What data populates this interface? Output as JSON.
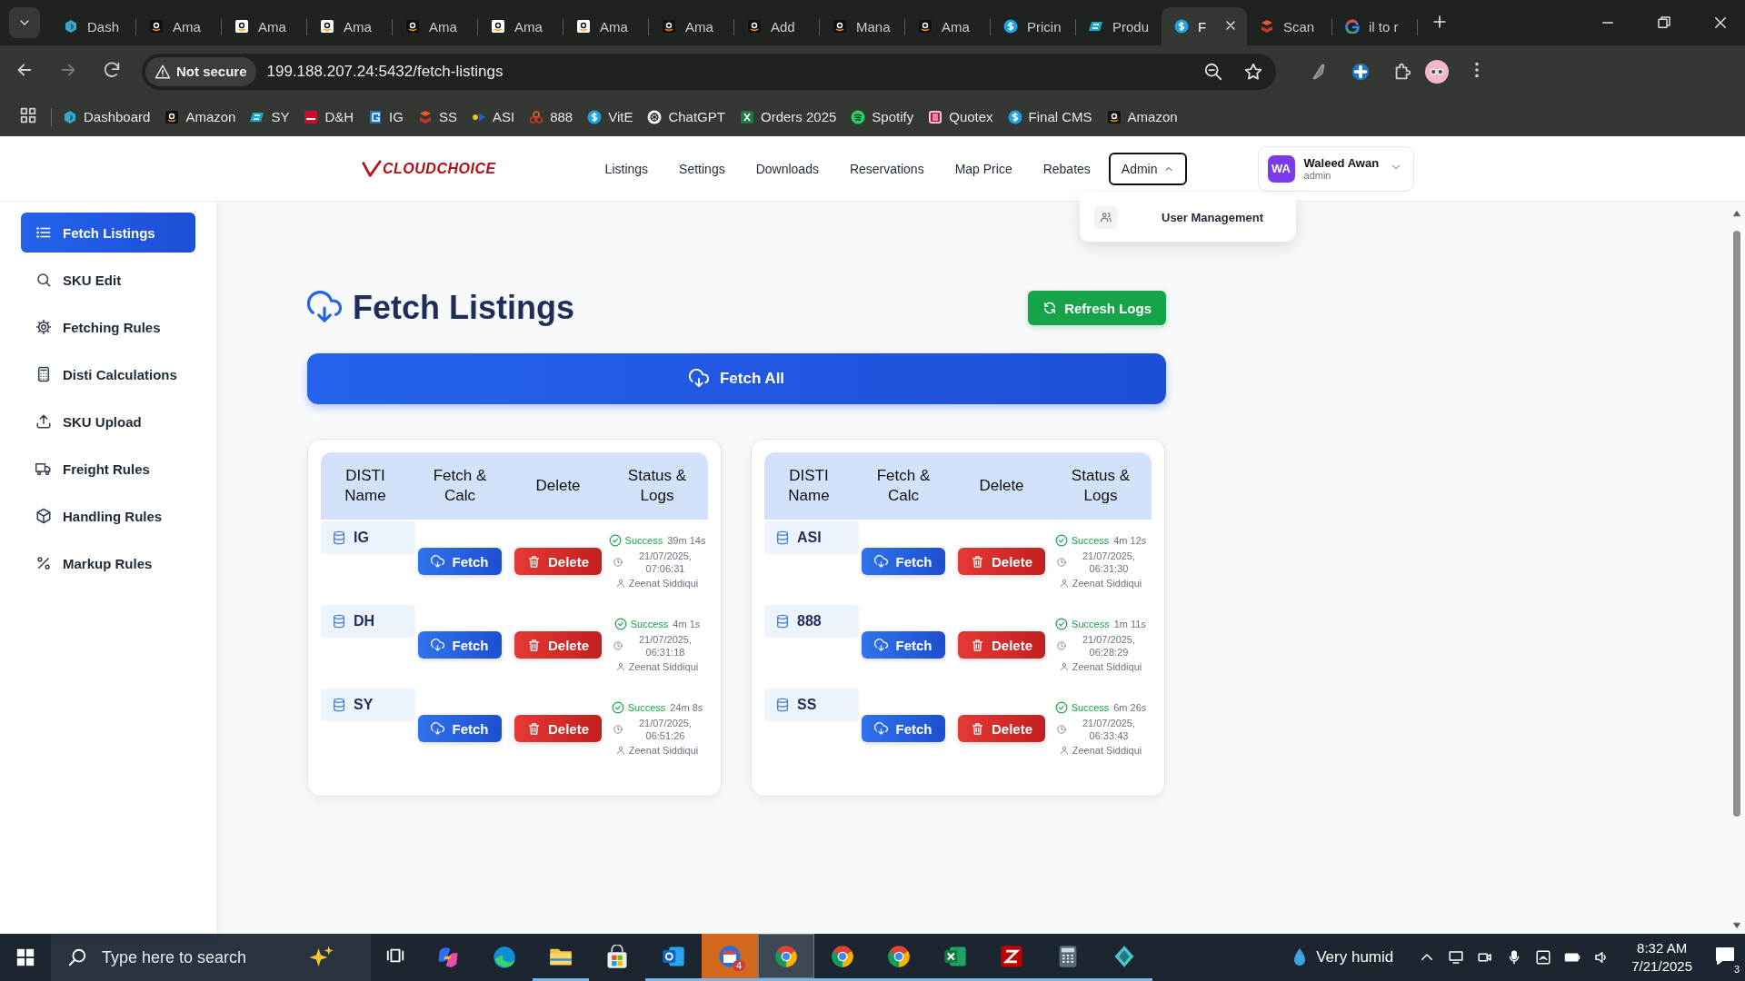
{
  "browser": {
    "tabs": [
      {
        "kind": "dash",
        "title": "Dash",
        "selected": false
      },
      {
        "kind": "amazon",
        "title": "Ama",
        "selected": false
      },
      {
        "kind": "amazon-light",
        "title": "Ama",
        "selected": false
      },
      {
        "kind": "amazon-light",
        "title": "Ama",
        "selected": false
      },
      {
        "kind": "amazon",
        "title": "Ama",
        "selected": false
      },
      {
        "kind": "amazon-light",
        "title": "Ama",
        "selected": false
      },
      {
        "kind": "amazon-light",
        "title": "Ama",
        "selected": false
      },
      {
        "kind": "amazon",
        "title": "Ama",
        "selected": false
      },
      {
        "kind": "amazon",
        "title": "Add",
        "selected": false
      },
      {
        "kind": "amazon",
        "title": "Mana",
        "selected": false
      },
      {
        "kind": "amazon",
        "title": "Ama",
        "selected": false
      },
      {
        "kind": "dollar",
        "title": "Pricin",
        "selected": false
      },
      {
        "kind": "ec",
        "title": "Produ",
        "selected": false
      },
      {
        "kind": "dollar",
        "title": "F",
        "selected": true
      },
      {
        "kind": "cubes",
        "title": "Scan",
        "selected": false
      },
      {
        "kind": "google",
        "title": "il to r",
        "selected": false
      }
    ],
    "address": {
      "security": "Not secure",
      "url": "199.188.207.24:5432/fetch-listings"
    },
    "bookmarks": [
      {
        "kind": "dash",
        "label": "Dashboard"
      },
      {
        "kind": "amazon",
        "label": "Amazon"
      },
      {
        "kind": "ec",
        "label": "SY"
      },
      {
        "kind": "dh",
        "label": "D&H"
      },
      {
        "kind": "ig",
        "label": "IG"
      },
      {
        "kind": "cubes",
        "label": "SS"
      },
      {
        "kind": "asi",
        "label": "ASI"
      },
      {
        "kind": "rings",
        "label": "888"
      },
      {
        "kind": "dollar",
        "label": "VitE"
      },
      {
        "kind": "knot",
        "label": "ChatGPT"
      },
      {
        "kind": "excel",
        "label": "Orders 2025"
      },
      {
        "kind": "spotify",
        "label": "Spotify"
      },
      {
        "kind": "quotex",
        "label": "Quotex"
      },
      {
        "kind": "dollar",
        "label": "Final CMS"
      },
      {
        "kind": "amazon",
        "label": "Amazon"
      }
    ]
  },
  "header": {
    "logo": "CLOUDCHOICE",
    "nav": [
      {
        "label": "Listings",
        "selected": false
      },
      {
        "label": "Settings",
        "selected": false
      },
      {
        "label": "Downloads",
        "selected": false
      },
      {
        "label": "Reservations",
        "selected": false
      },
      {
        "label": "Map Price",
        "selected": false
      },
      {
        "label": "Rebates",
        "selected": false
      },
      {
        "label": "Admin",
        "selected": true
      }
    ],
    "menu": {
      "open": true,
      "items": [
        {
          "label": "User Management"
        }
      ]
    },
    "user": {
      "initials": "WA",
      "name": "Waleed Awan",
      "role": "admin"
    }
  },
  "sidebar": {
    "items": [
      {
        "kind": "list",
        "label": "Fetch Listings",
        "selected": true
      },
      {
        "kind": "search",
        "label": "SKU Edit",
        "selected": false
      },
      {
        "kind": "gear",
        "label": "Fetching Rules",
        "selected": false
      },
      {
        "kind": "calc",
        "label": "Disti Calculations",
        "selected": false
      },
      {
        "kind": "upload",
        "label": "SKU Upload",
        "selected": false
      },
      {
        "kind": "truck",
        "label": "Freight Rules",
        "selected": false
      },
      {
        "kind": "box",
        "label": "Handling Rules",
        "selected": false
      },
      {
        "kind": "percent",
        "label": "Markup Rules",
        "selected": false
      }
    ]
  },
  "page": {
    "title": "Fetch Listings",
    "refresh_button": "Refresh Logs",
    "fetch_all_button": "Fetch All",
    "tables": [
      {
        "columns": [
          "DISTI Name",
          "Fetch & Calc",
          "Delete",
          "Status & Logs"
        ],
        "rows": [
          {
            "name": "IG",
            "fetch": "Fetch",
            "delete": "Delete",
            "succeeded": true,
            "status": "Success",
            "duration": "39m 14s",
            "time": "21/07/2025, 07:06:31",
            "user": "Zeenat Siddiqui"
          },
          {
            "name": "DH",
            "fetch": "Fetch",
            "delete": "Delete",
            "succeeded": true,
            "status": "Success",
            "duration": "4m 1s",
            "time": "21/07/2025, 06:31:18",
            "user": "Zeenat Siddiqui"
          },
          {
            "name": "SY",
            "fetch": "Fetch",
            "delete": "Delete",
            "succeeded": true,
            "status": "Success",
            "duration": "24m 8s",
            "time": "21/07/2025, 06:51:26",
            "user": "Zeenat Siddiqui"
          }
        ]
      },
      {
        "columns": [
          "DISTI Name",
          "Fetch & Calc",
          "Delete",
          "Status & Logs"
        ],
        "rows": [
          {
            "name": "ASI",
            "fetch": "Fetch",
            "delete": "Delete",
            "succeeded": true,
            "status": "Success",
            "duration": "4m 12s",
            "time": "21/07/2025, 06:31:30",
            "user": "Zeenat Siddiqui"
          },
          {
            "name": "888",
            "fetch": "Fetch",
            "delete": "Delete",
            "succeeded": true,
            "status": "Success",
            "duration": "1m 11s",
            "time": "21/07/2025, 06:28:29",
            "user": "Zeenat Siddiqui"
          },
          {
            "name": "SS",
            "fetch": "Fetch",
            "delete": "Delete",
            "succeeded": true,
            "status": "Success",
            "duration": "6m 26s",
            "time": "21/07/2025, 06:33:43",
            "user": "Zeenat Siddiqui"
          }
        ]
      }
    ]
  },
  "taskbar": {
    "search_placeholder": "Type here to search",
    "apps": [
      {
        "kind": "copilot",
        "running": false,
        "selected": false,
        "flashing": false
      },
      {
        "kind": "edge",
        "running": false,
        "selected": false,
        "flashing": false
      },
      {
        "kind": "folder",
        "running": true,
        "selected": false,
        "flashing": false
      },
      {
        "kind": "store",
        "running": false,
        "selected": false,
        "flashing": false
      },
      {
        "kind": "mail",
        "running": true,
        "selected": false,
        "flashing": false
      },
      {
        "kind": "calendar",
        "running": true,
        "selected": false,
        "flashing": true,
        "badge": "4"
      },
      {
        "kind": "chrome",
        "running": true,
        "selected": true,
        "flashing": false
      },
      {
        "kind": "chrome",
        "running": true,
        "selected": false,
        "flashing": false
      },
      {
        "kind": "chrome",
        "running": true,
        "selected": false,
        "flashing": false
      },
      {
        "kind": "excel",
        "running": true,
        "selected": false,
        "flashing": false
      },
      {
        "kind": "zigzag",
        "running": true,
        "selected": false,
        "flashing": false
      },
      {
        "kind": "calculator",
        "running": true,
        "selected": false,
        "flashing": false
      },
      {
        "kind": "diamond",
        "running": true,
        "selected": false,
        "flashing": false
      }
    ],
    "weather": "Very humid",
    "time": "8:32 AM",
    "date": "7/21/2025",
    "notifications": "3"
  }
}
